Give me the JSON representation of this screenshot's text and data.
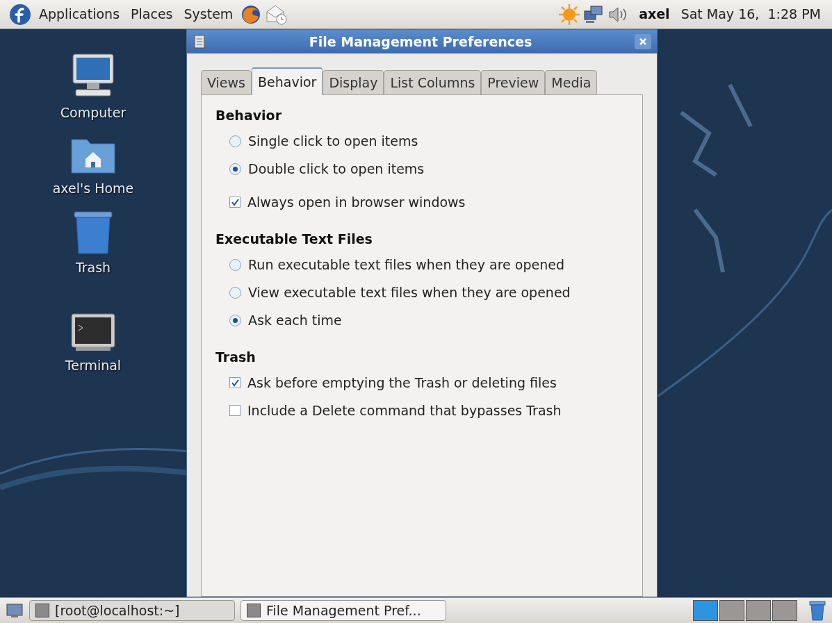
{
  "top_panel": {
    "menus": [
      "Applications",
      "Places",
      "System"
    ],
    "user": "axel",
    "clock": "Sat May 16,  1:28 PM"
  },
  "desktop_icons": [
    {
      "kind": "computer",
      "label": "Computer"
    },
    {
      "kind": "home",
      "label": "axel's Home"
    },
    {
      "kind": "trash",
      "label": "Trash"
    },
    {
      "kind": "terminal",
      "label": "Terminal"
    }
  ],
  "window": {
    "title": "File Management Preferences",
    "tabs": [
      {
        "label": "Views",
        "selected": false
      },
      {
        "label": "Behavior",
        "selected": true
      },
      {
        "label": "Display",
        "selected": false
      },
      {
        "label": "List Columns",
        "selected": false
      },
      {
        "label": "Preview",
        "selected": false
      },
      {
        "label": "Media",
        "selected": false
      }
    ],
    "sections": [
      {
        "heading": "Behavior",
        "options": [
          {
            "kind": "radio",
            "label": "Single click to open items",
            "checked": false
          },
          {
            "kind": "radio",
            "label": "Double click to open items",
            "checked": true
          },
          {
            "kind": "checkbox",
            "label": "Always open in browser windows",
            "checked": true
          }
        ]
      },
      {
        "heading": "Executable Text Files",
        "options": [
          {
            "kind": "radio",
            "label": "Run executable text files when they are opened",
            "checked": false
          },
          {
            "kind": "radio",
            "label": "View executable text files when they are opened",
            "checked": false
          },
          {
            "kind": "radio",
            "label": "Ask each time",
            "checked": true
          }
        ]
      },
      {
        "heading": "Trash",
        "options": [
          {
            "kind": "checkbox",
            "label": "Ask before emptying the Trash or deleting files",
            "checked": true
          },
          {
            "kind": "checkbox",
            "label": "Include a Delete command that bypasses Trash",
            "checked": false
          }
        ]
      }
    ]
  },
  "taskbar": {
    "items": [
      {
        "label": "[root@localhost:~]",
        "selected": false
      },
      {
        "label": "File Management Pref...",
        "selected": true
      }
    ],
    "workspaces": [
      {
        "selected": true
      },
      {
        "selected": false
      },
      {
        "selected": false
      },
      {
        "selected": false
      }
    ]
  }
}
